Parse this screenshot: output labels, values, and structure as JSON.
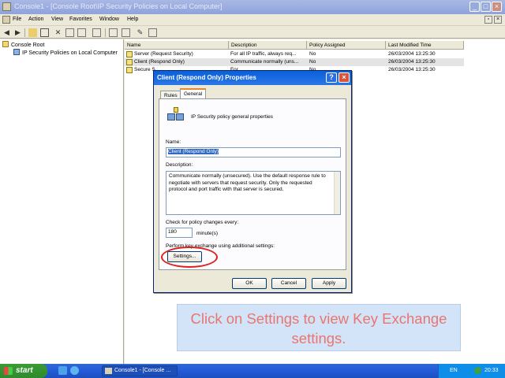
{
  "window": {
    "title": "Console1 - [Console Root\\IP Security Policies on Local Computer]",
    "min": "_",
    "max": "□",
    "close": "×"
  },
  "menu": {
    "items": [
      "File",
      "Action",
      "View",
      "Favorites",
      "Window",
      "Help"
    ],
    "restore": "▫",
    "close": "×"
  },
  "tree": {
    "root": "Console Root",
    "child": "IP Security Policies on Local Computer"
  },
  "list": {
    "columns": [
      "Name",
      "Description",
      "Policy Assigned",
      "Last Modified Time"
    ],
    "rows": [
      {
        "name": "Server (Request Security)",
        "description": "For all IP traffic, always req...",
        "assigned": "No",
        "modified": "26/03/2004 13:25:30"
      },
      {
        "name": "Client (Respond Only)",
        "description": "Communicate normally (uns...",
        "assigned": "No",
        "modified": "26/03/2004 13:25:30"
      },
      {
        "name": "Secure S",
        "description": "For",
        "assigned": "No",
        "modified": "26/03/2004 13:25:30"
      }
    ]
  },
  "dialog": {
    "title": "Client (Respond Only) Properties",
    "help": "?",
    "close": "×",
    "tabs": [
      "Rules",
      "General"
    ],
    "heading": "IP Security policy general properties",
    "name_label": "Name:",
    "name_value": "Client (Respond Only)",
    "description_label": "Description:",
    "description_value": "Communicate normally (unsecured). Use the default response rule to negotiate with servers that request security. Only the requested protocol and port traffic with that server is secured.",
    "check_label": "Check for policy changes every:",
    "check_value": "180",
    "check_unit": "minute(s)",
    "key_exchange_label": "Perform key exchange using additional settings:",
    "settings_button": "Settings...",
    "ok": "OK",
    "cancel": "Cancel",
    "apply": "Apply"
  },
  "caption": "Click on Settings to view Key Exchange settings.",
  "taskbar": {
    "start": "start",
    "task": "Console1 - [Console ...",
    "lang": "EN",
    "clock": "20:33"
  },
  "colors": {
    "highlight_circle": "#e0201c",
    "caption_text": "#e8766f",
    "caption_bg": "#d3e4f9"
  }
}
